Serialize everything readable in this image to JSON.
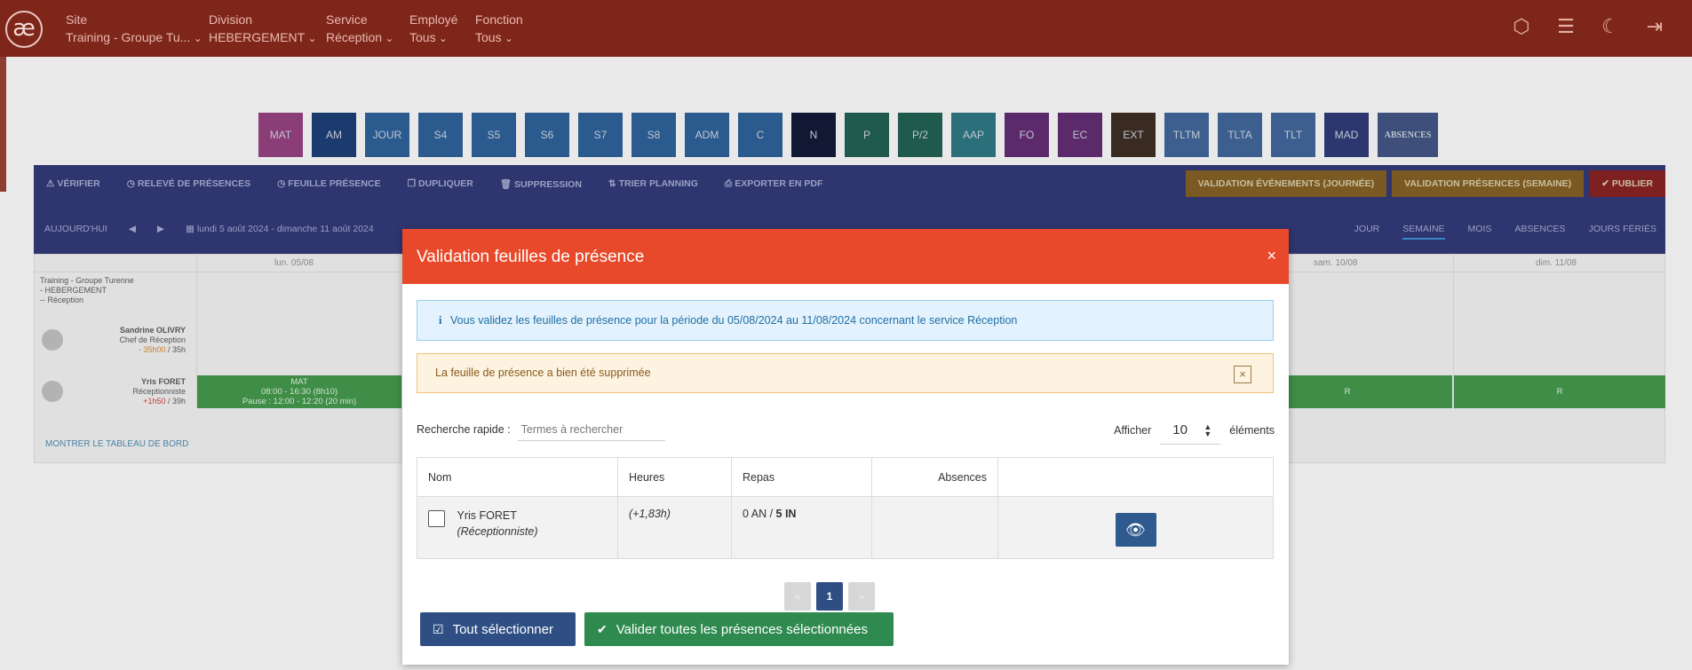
{
  "topbar": {
    "logo": "æ",
    "nav": [
      {
        "label": "Site",
        "value": "Training - Groupe Tu..."
      },
      {
        "label": "Division",
        "value": "HEBERGEMENT"
      },
      {
        "label": "Service",
        "value": "Réception"
      },
      {
        "label": "Employé",
        "value": "Tous"
      },
      {
        "label": "Fonction",
        "value": "Tous"
      }
    ],
    "icons": [
      "cube-icon",
      "list-indent-icon",
      "moon-icon",
      "logout-icon"
    ]
  },
  "codes": [
    "MAT",
    "AM",
    "JOUR",
    "S4",
    "S5",
    "S6",
    "S7",
    "S8",
    "ADM",
    "C",
    "N",
    "P",
    "P/2",
    "AAP",
    "FO",
    "EC",
    "EXT",
    "TLTM",
    "TLTA",
    "TLT",
    "MAD",
    "ABSENCES"
  ],
  "code_colors": [
    "#8a3d77",
    "#1b3b6f",
    "#2b5a8f",
    "#2b5a8f",
    "#2b5a8f",
    "#2b5a8f",
    "#2b5a8f",
    "#2b5a8f",
    "#2b5a8f",
    "#2b5a8f",
    "#111833",
    "#1f5a4d",
    "#1f5a4d",
    "#2a6f7a",
    "#5c2a6b",
    "#5c2a6b",
    "#3a2b22",
    "#3d5f8f",
    "#3d5f8f",
    "#3d5f8f",
    "#2c376f",
    "#3d4f7a"
  ],
  "toolbar": {
    "actions": [
      "VÉRIFIER",
      "RELEVÉ DE PRÉSENCES",
      "FEUILLE PRÉSENCE",
      "DUPLIQUER",
      "SUPPRESSION",
      "TRIER PLANNING",
      "EXPORTER EN PDF"
    ],
    "right_actions": [
      "VALIDATION ÉVÉNEMENTS (JOURNÉE)",
      "VALIDATION PRÉSENCES (SEMAINE)",
      "✔ PUBLIER"
    ],
    "right_colors": [
      "#7a5a22",
      "#7a5a22",
      "#7f2020"
    ],
    "today": "AUJOURD'HUI",
    "prev": "◀",
    "next": "▶",
    "period": "lundi 5 août 2024 - dimanche 11 août 2024",
    "views": [
      "JOUR",
      "SEMAINE",
      "MOIS",
      "ABSENCES",
      "JOURS FÉRIÉS"
    ]
  },
  "grid": {
    "days": [
      "lun. 05/08",
      "sam. 10/08",
      "dim. 11/08"
    ],
    "group_label": [
      "Training - Groupe Turenne",
      "- HEBERGEMENT",
      "-- Réception"
    ],
    "employee1": {
      "name": "Sandrine OLIVRY",
      "role": "Chef de Réception",
      "hours_delta": "- 35h00",
      "hours_total": " / 35h"
    },
    "employee2": {
      "name": "Yris FORET",
      "role": "Réceptionniste",
      "hours_delta": "+1h50",
      "hours_total": " / 39h"
    },
    "shift": {
      "code": "MAT",
      "time": "08:00 - 16:30 (8h10)",
      "pause": "Pause : 12:00 - 12:20 (20 min)"
    },
    "r_label": "R",
    "dashboard_link": "MONTRER LE TABLEAU DE BORD"
  },
  "modal": {
    "title": "Validation feuilles de présence",
    "close": "×",
    "info_icon": "i",
    "info_text": "Vous validez les feuilles de présence pour la période du 05/08/2024 au 11/08/2024 concernant le service Réception",
    "warning_text": "La feuille de présence a bien été supprimée",
    "warning_close": "×",
    "search_label": "Recherche rapide :",
    "search_placeholder": "Termes à rechercher",
    "show_label": "Afficher",
    "show_value": "10",
    "show_suffix": "éléments",
    "columns": [
      "Nom",
      "Heures",
      "Repas",
      "Absences",
      ""
    ],
    "row": {
      "name": "Yris FORET",
      "role": "(Réceptionniste)",
      "hours": "(+1,83h)",
      "repas_prefix": "0 AN / ",
      "repas_bold": "5 IN",
      "absences": ""
    },
    "pager": {
      "prev": "«",
      "current": "1",
      "next": "»"
    },
    "btn_select_all": "Tout sélectionner",
    "btn_validate": "Valider toutes les présences sélectionnées"
  }
}
